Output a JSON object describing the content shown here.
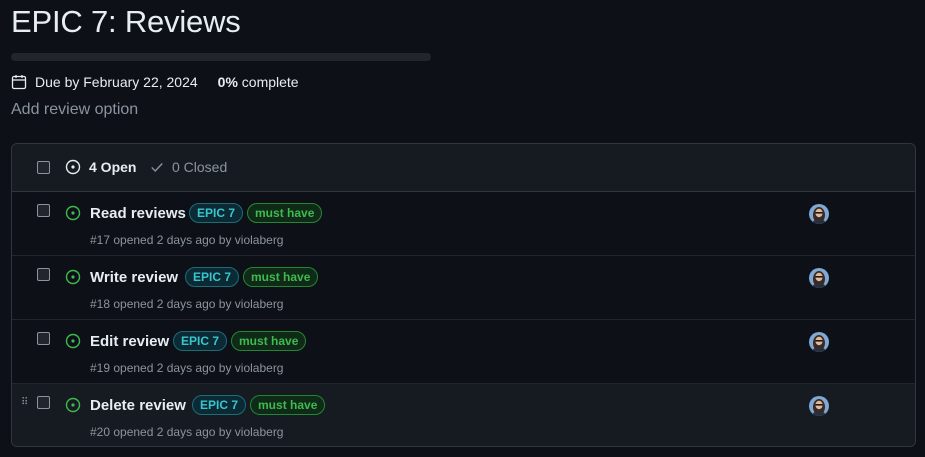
{
  "milestone": {
    "title": "EPIC 7: Reviews",
    "due": "Due by February 22, 2024",
    "percent": "0%",
    "complete_text": "complete",
    "progress": 0
  },
  "add_review_option": "Add review option",
  "header": {
    "open_label": "4 Open",
    "closed_label": "0 Closed"
  },
  "colors": {
    "open_icon": "#3fb950",
    "epic_label": "#39c5cf",
    "must_label": "#3fb950"
  },
  "issues": [
    {
      "title": "Read reviews",
      "labels": [
        "EPIC 7",
        "must have"
      ],
      "meta": "#17 opened 2 days ago by violaberg"
    },
    {
      "title": "Write review",
      "labels": [
        "EPIC 7",
        "must have"
      ],
      "meta": "#18 opened 2 days ago by violaberg"
    },
    {
      "title": "Edit review",
      "labels": [
        "EPIC 7",
        "must have"
      ],
      "meta": "#19 opened 2 days ago by violaberg"
    },
    {
      "title": "Delete review",
      "labels": [
        "EPIC 7",
        "must have"
      ],
      "meta": "#20 opened 2 days ago by violaberg"
    }
  ]
}
